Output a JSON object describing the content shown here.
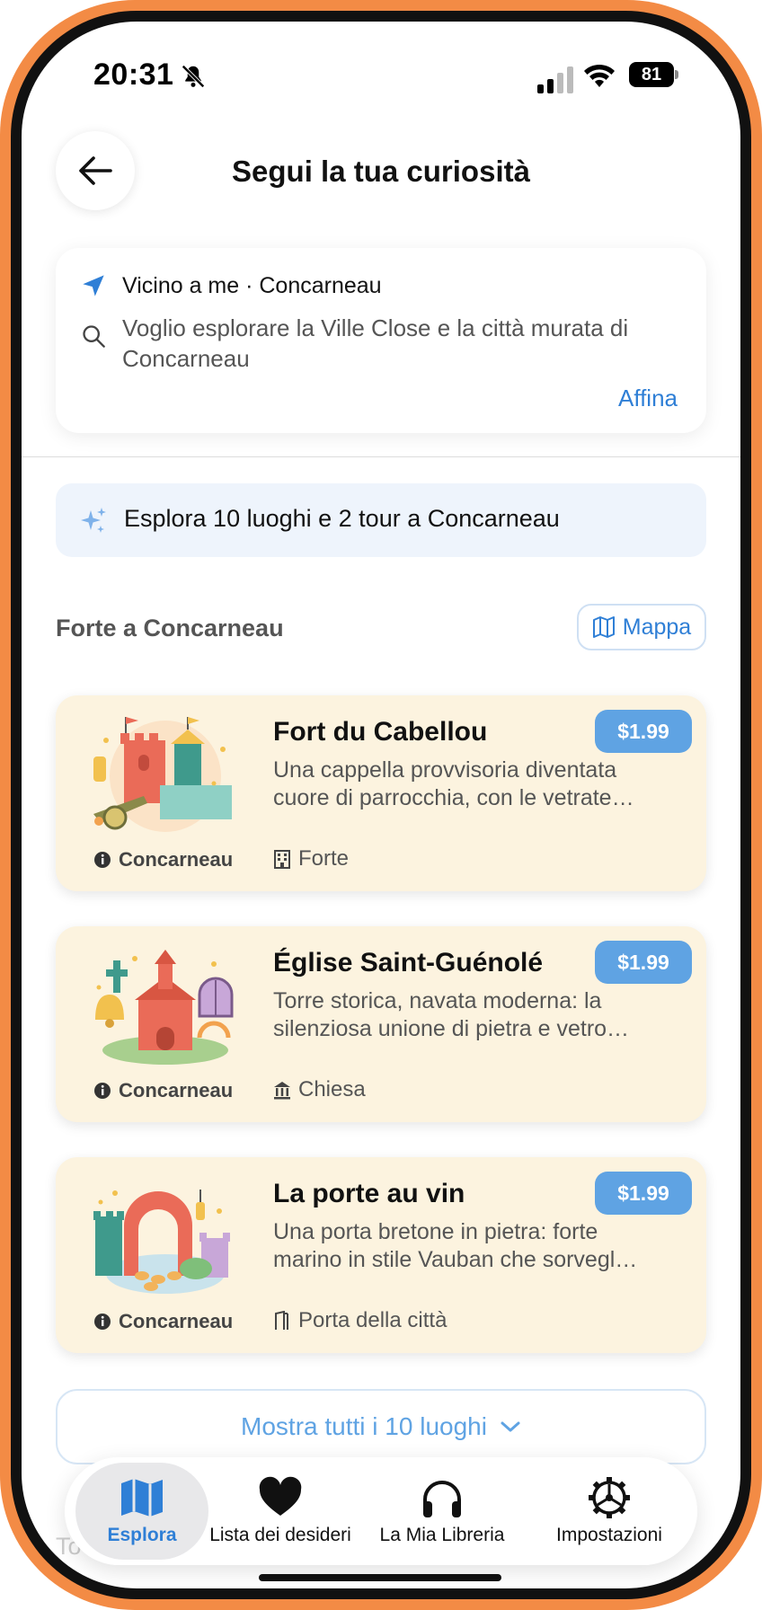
{
  "status_bar": {
    "time": "20:31",
    "battery": "81"
  },
  "header": {
    "title": "Segui la tua curiosità"
  },
  "search": {
    "location": "Vicino a me · Concarneau",
    "query": "Voglio esplorare la Ville Close e la città murata di Concarneau",
    "refine_label": "Affina"
  },
  "banner": {
    "text": "Esplora 10 luoghi e 2 tour a Concarneau"
  },
  "section": {
    "title": "Forte a Concarneau",
    "map_label": "Mappa"
  },
  "places": [
    {
      "name": "Fort du Cabellou",
      "description": "Una cappella provvisoria diventata cuore di parrocchia, con le vetrate…",
      "city": "Concarneau",
      "type": "Forte",
      "price": "$1.99"
    },
    {
      "name": "Église Saint-Guénolé",
      "description": "Torre storica, navata moderna: la silenziosa unione di pietra e vetro…",
      "city": "Concarneau",
      "type": "Chiesa",
      "price": "$1.99"
    },
    {
      "name": "La porte au vin",
      "description": "Una porta bretone in pietra: forte marino in stile Vauban che sorvegl…",
      "city": "Concarneau",
      "type": "Porta della città",
      "price": "$1.99"
    }
  ],
  "show_all": {
    "label": "Mostra tutti i 10 luoghi"
  },
  "faded_heading": "To",
  "tabs": [
    {
      "label": "Esplora",
      "icon": "map-icon",
      "active": true
    },
    {
      "label": "Lista dei desideri",
      "icon": "heart-icon",
      "active": false
    },
    {
      "label": "La Mia Libreria",
      "icon": "headphones-icon",
      "active": false
    },
    {
      "label": "Impostazioni",
      "icon": "gear-icon",
      "active": false
    }
  ],
  "colors": {
    "frame": "#f38b45",
    "accent": "#2f7fd6",
    "card_bg": "#fcf3df",
    "badge": "#5fa3e3",
    "banner_bg": "#eef4fc"
  }
}
